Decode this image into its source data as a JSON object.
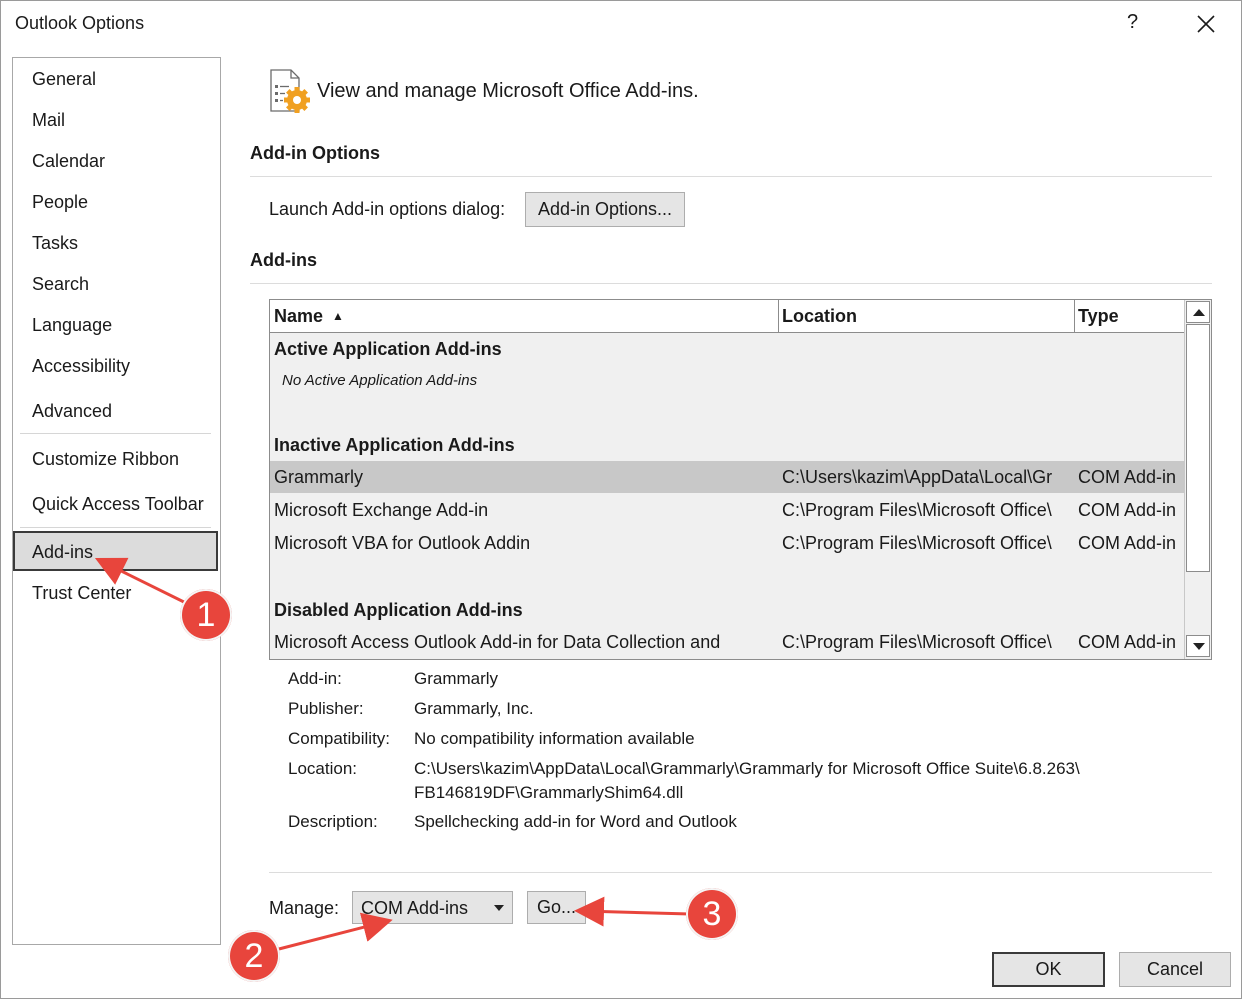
{
  "window": {
    "title": "Outlook Options",
    "help_label": "?",
    "close_icon": "close-icon"
  },
  "sidebar": {
    "items": [
      {
        "label": "General"
      },
      {
        "label": "Mail"
      },
      {
        "label": "Calendar"
      },
      {
        "label": "People"
      },
      {
        "label": "Tasks"
      },
      {
        "label": "Search"
      },
      {
        "label": "Language"
      },
      {
        "label": "Accessibility"
      },
      {
        "label": "Advanced"
      },
      {
        "label": "Customize Ribbon"
      },
      {
        "label": "Quick Access Toolbar"
      },
      {
        "label": "Add-ins"
      },
      {
        "label": "Trust Center"
      }
    ],
    "selected": "Add-ins"
  },
  "main": {
    "header_text": "View and manage Microsoft Office Add-ins.",
    "header_icon": "addins-settings-icon",
    "addin_options_section": "Add-in Options",
    "launch_label": "Launch Add-in options dialog:",
    "addin_options_button": "Add-in Options...",
    "addins_section": "Add-ins"
  },
  "list": {
    "columns": {
      "name": "Name",
      "location": "Location",
      "type": "Type"
    },
    "sort_indicator": "▲",
    "groups": {
      "active": "Active Application Add-ins",
      "active_empty": "No Active Application Add-ins",
      "inactive": "Inactive Application Add-ins",
      "disabled": "Disabled Application Add-ins"
    },
    "inactive_rows": [
      {
        "name": "Grammarly",
        "location": "C:\\Users\\kazim\\AppData\\Local\\Gr",
        "type": "COM Add-in"
      },
      {
        "name": "Microsoft Exchange Add-in",
        "location": "C:\\Program Files\\Microsoft Office\\",
        "type": "COM Add-in"
      },
      {
        "name": "Microsoft VBA for Outlook Addin",
        "location": "C:\\Program Files\\Microsoft Office\\",
        "type": "COM Add-in"
      }
    ],
    "disabled_rows": [
      {
        "name": "Microsoft Access Outlook Add-in for Data Collection and",
        "location": "C:\\Program Files\\Microsoft Office\\",
        "type": "COM Add-in"
      }
    ]
  },
  "details": {
    "addin_label": "Add-in:",
    "addin_value": "Grammarly",
    "publisher_label": "Publisher:",
    "publisher_value": "Grammarly, Inc.",
    "compat_label": "Compatibility:",
    "compat_value": "No compatibility information available",
    "location_label": "Location:",
    "location_value_1": "C:\\Users\\kazim\\AppData\\Local\\Grammarly\\Grammarly for Microsoft Office Suite\\6.8.263\\",
    "location_value_2": "FB146819DF\\GrammarlyShim64.dll",
    "desc_label": "Description:",
    "desc_value": "Spellchecking add-in for Word and Outlook"
  },
  "manage": {
    "label": "Manage:",
    "selected_option": "COM Add-ins",
    "go_button": "Go..."
  },
  "footer": {
    "ok_button": "OK",
    "cancel_button": "Cancel"
  },
  "annotations": {
    "badge_1": "1",
    "badge_2": "2",
    "badge_3": "3",
    "color": "#e8453c"
  }
}
